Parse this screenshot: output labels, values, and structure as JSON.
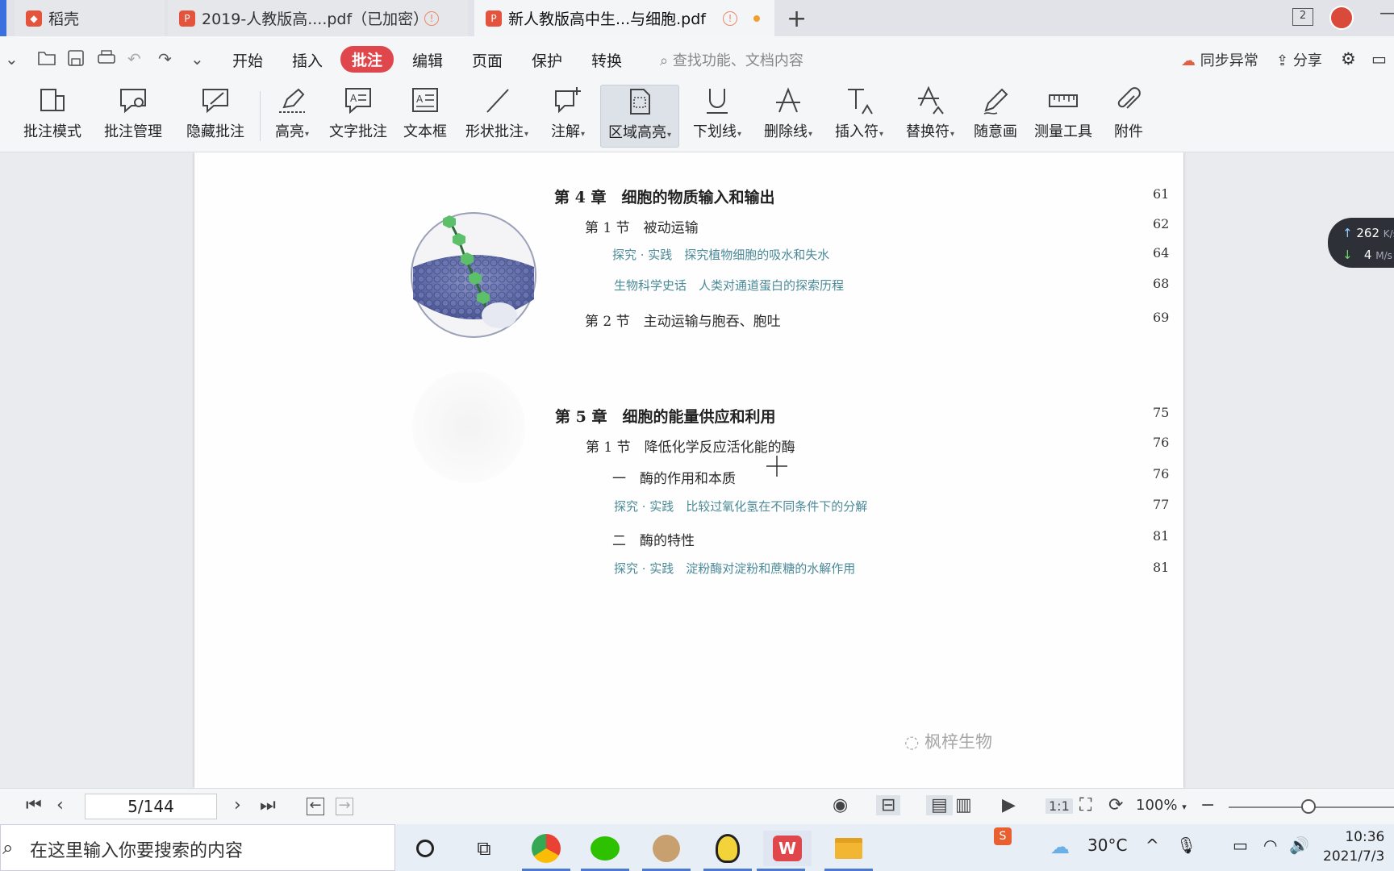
{
  "tabs": [
    {
      "label": "稻壳",
      "active": false
    },
    {
      "label": "2019-人教版高....pdf（已加密）",
      "active": false
    },
    {
      "label": "新人教版高中生...与细胞.pdf",
      "active": true
    }
  ],
  "menu": {
    "items": [
      "开始",
      "插入",
      "批注",
      "编辑",
      "页面",
      "保护",
      "转换"
    ],
    "active": "批注",
    "search_placeholder": "查找功能、文档内容",
    "sync": "同步异常",
    "share": "分享"
  },
  "ribbon": {
    "items": [
      "批注模式",
      "批注管理",
      "隐藏批注",
      "高亮",
      "文字批注",
      "文本框",
      "形状批注",
      "注解",
      "区域高亮",
      "下划线",
      "删除线",
      "插入符",
      "替换符",
      "随意画",
      "测量工具",
      "附件"
    ],
    "selected": "区域高亮"
  },
  "document": {
    "toc": [
      {
        "text": "第 4 章　细胞的物质输入和输出",
        "page": "61",
        "kind": "chapter"
      },
      {
        "text": "第 1 节　被动运输",
        "page": "62",
        "kind": "section"
      },
      {
        "text": "探究 · 实践　探究植物细胞的吸水和失水",
        "page": "64",
        "kind": "explore"
      },
      {
        "text": "生物科学史话　人类对通道蛋白的探索历程",
        "page": "68",
        "kind": "explore"
      },
      {
        "text": "第 2 节　主动运输与胞吞、胞吐",
        "page": "69",
        "kind": "section"
      },
      {
        "text": "第 5 章　细胞的能量供应和利用",
        "page": "75",
        "kind": "chapter"
      },
      {
        "text": "第 1 节　降低化学反应活化能的酶",
        "page": "76",
        "kind": "section"
      },
      {
        "text": "一　酶的作用和本质",
        "page": "76",
        "kind": "section"
      },
      {
        "text": "探究 · 实践　比较过氧化氢在不同条件下的分解",
        "page": "77",
        "kind": "explore"
      },
      {
        "text": "二　酶的特性",
        "page": "81",
        "kind": "section"
      },
      {
        "text": "探究 · 实践　淀粉酶对淀粉和蔗糖的水解作用",
        "page": "81",
        "kind": "explore"
      }
    ],
    "watermark": "枫梓生物"
  },
  "network": {
    "up": "262",
    "up_unit": "K/s",
    "down": "4",
    "down_unit": "M/s"
  },
  "status": {
    "page_indicator": "5/144",
    "zoom": "100%"
  },
  "taskbar": {
    "search_placeholder": "在这里输入你要搜索的内容",
    "weather": "30°C",
    "time": "10:36",
    "date": "2021/7/3"
  },
  "colors": {
    "accent": "#e0474c",
    "explore_text": "#4b8a98",
    "taskbar_bg": "#e8eef6"
  }
}
